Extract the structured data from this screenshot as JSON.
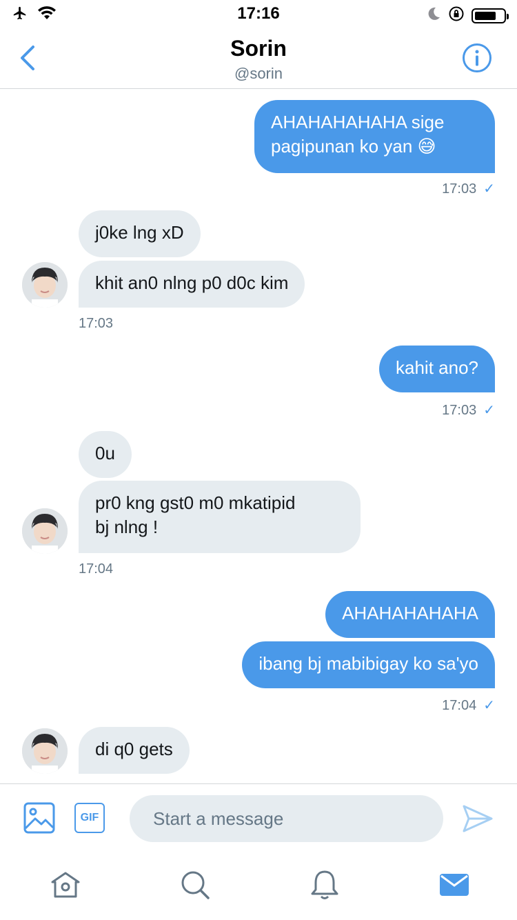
{
  "status_bar": {
    "time": "17:16"
  },
  "header": {
    "name": "Sorin",
    "handle": "@sorin"
  },
  "messages": {
    "m1": {
      "text_line1": "AHAHAHAHAHA sige",
      "text_line2": "pagipunan ko yan",
      "emoji": "😅",
      "time": "17:03"
    },
    "m2": {
      "text": "j0ke lng xD"
    },
    "m3": {
      "text": "khit an0 nlng p0 d0c kim",
      "time": "17:03"
    },
    "m4": {
      "text": "kahit ano?",
      "time": "17:03"
    },
    "m5": {
      "text": "0u"
    },
    "m6": {
      "text_line1": "pr0 kng gst0 m0 mkatipid",
      "text_line2": "bj nlng !",
      "time": "17:04"
    },
    "m7": {
      "text": "AHAHAHAHAHA"
    },
    "m8": {
      "text": "ibang bj mabibigay ko sa'yo",
      "time": "17:04"
    },
    "m9": {
      "text": "di q0 gets"
    }
  },
  "composer": {
    "placeholder": "Start a message",
    "gif_label": "GIF"
  },
  "icons": {
    "back": "chevron-left-icon",
    "info": "info-icon",
    "image": "image-icon",
    "send": "send-icon",
    "home": "home-icon",
    "search": "search-icon",
    "notifications": "bell-icon",
    "messages": "mail-icon"
  },
  "colors": {
    "accent": "#4a99e9",
    "incoming_bubble": "#e6ecf0",
    "secondary_text": "#657786"
  }
}
